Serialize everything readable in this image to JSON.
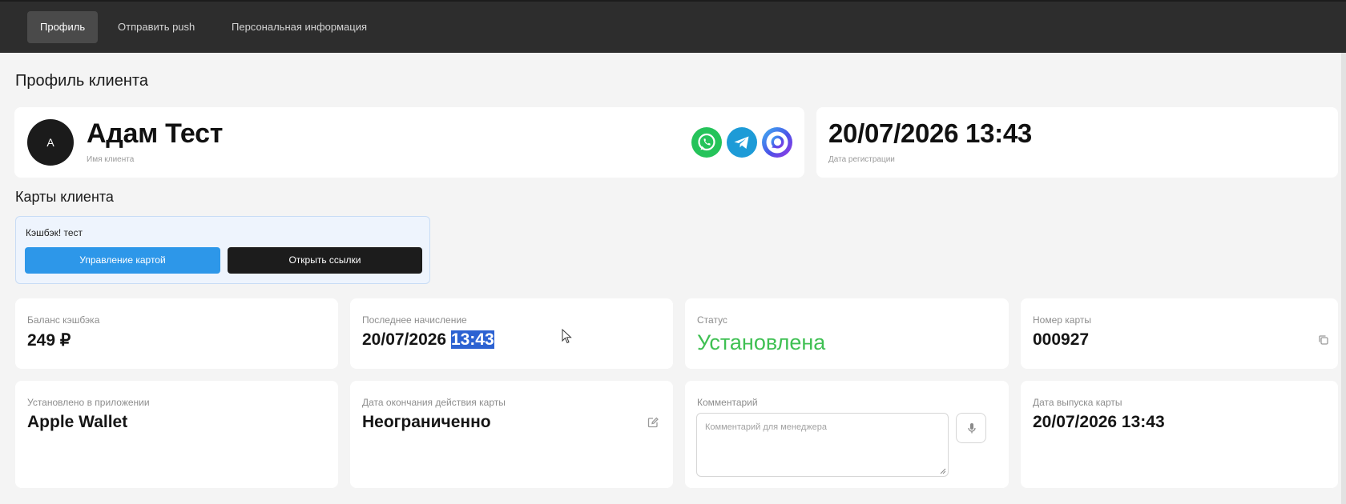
{
  "tabs": [
    {
      "label": "Профиль",
      "active": true
    },
    {
      "label": "Отправить push",
      "active": false
    },
    {
      "label": "Персональная информация",
      "active": false
    }
  ],
  "page_title": "Профиль клиента",
  "client": {
    "avatar_letter": "A",
    "name": "Адам Тест",
    "name_caption": "Имя клиента",
    "socials": [
      "whatsapp-icon",
      "telegram-icon",
      "max-messenger-icon"
    ]
  },
  "registration": {
    "value": "20/07/2026 13:43",
    "caption": "Дата регистрации"
  },
  "cards_title": "Карты клиента",
  "loyalty_card": {
    "name": "Кэшбэк! тест",
    "manage_label": "Управление картой",
    "links_label": "Открыть ссылки"
  },
  "fields": {
    "balance": {
      "label": "Баланс кэшбэка",
      "value": "249 ₽"
    },
    "last_accrual": {
      "label": "Последнее начисление",
      "date": "20/07/2026",
      "time": "13:43"
    },
    "status": {
      "label": "Статус",
      "value": "Установлена"
    },
    "card_number": {
      "label": "Номер карты",
      "value": "000927"
    },
    "installed_in": {
      "label": "Установлено в приложении",
      "value": "Apple Wallet"
    },
    "expiry": {
      "label": "Дата окончания действия карты",
      "value": "Неограниченно"
    },
    "comment": {
      "label": "Комментарий",
      "placeholder": "Комментарий для менеджера"
    },
    "issue_date": {
      "label": "Дата выпуска карты",
      "value": "20/07/2026 13:43"
    }
  },
  "colors": {
    "topbar": "#2d2d2d",
    "primary_button": "#2d97e9",
    "dark_button": "#1c1c1c",
    "status_green": "#3fc053",
    "selection": "#2c62d2",
    "whatsapp": "#25c35a",
    "telegram": "#1d9bd7"
  }
}
